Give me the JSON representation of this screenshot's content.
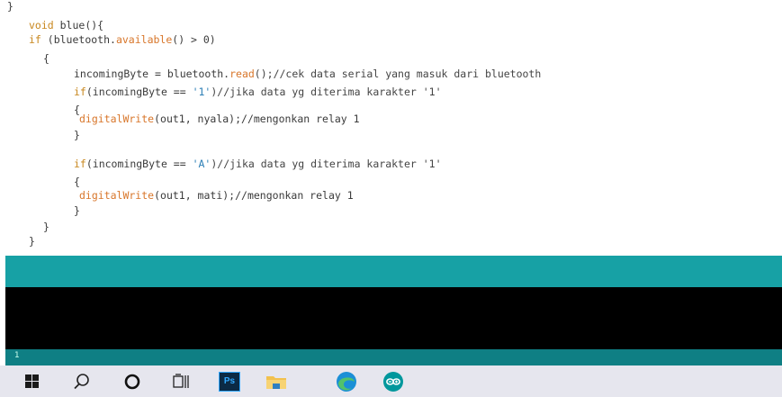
{
  "code": {
    "lines": [
      {
        "segments": [
          {
            "t": "}",
            "c": "pl"
          }
        ]
      },
      {
        "segments": [
          {
            "t": "void",
            "c": "kw"
          },
          {
            "t": " blue(){",
            "c": "pl"
          }
        ]
      },
      {
        "segments": [
          {
            "t": "if",
            "c": "kw"
          },
          {
            "t": " (bluetooth.",
            "c": "pl"
          },
          {
            "t": "available",
            "c": "fn"
          },
          {
            "t": "() > 0)",
            "c": "pl"
          }
        ]
      },
      {
        "segments": [
          {
            "t": "{",
            "c": "pl"
          }
        ]
      },
      {
        "segments": [
          {
            "t": "incomingByte = bluetooth.",
            "c": "pl"
          },
          {
            "t": "read",
            "c": "fn"
          },
          {
            "t": "();//cek data serial yang masuk dari bluetooth",
            "c": "cm"
          }
        ]
      },
      {
        "segments": [
          {
            "t": "if",
            "c": "kw"
          },
          {
            "t": "(incomingByte == ",
            "c": "pl"
          },
          {
            "t": "'1'",
            "c": "str"
          },
          {
            "t": ")//jika data yg diterima karakter '1'",
            "c": "cm"
          }
        ]
      },
      {
        "segments": [
          {
            "t": "{",
            "c": "pl"
          }
        ]
      },
      {
        "segments": [
          {
            "t": "digitalWrite",
            "c": "fn"
          },
          {
            "t": "(out1, nyala);//mengonkan relay 1",
            "c": "pl"
          }
        ]
      },
      {
        "segments": [
          {
            "t": "}",
            "c": "pl"
          }
        ]
      },
      {
        "segments": []
      },
      {
        "segments": [
          {
            "t": "if",
            "c": "kw"
          },
          {
            "t": "(incomingByte == ",
            "c": "pl"
          },
          {
            "t": "'A'",
            "c": "str"
          },
          {
            "t": ")//jika data yg diterima karakter '1'",
            "c": "cm"
          }
        ]
      },
      {
        "segments": [
          {
            "t": "{",
            "c": "pl"
          }
        ]
      },
      {
        "segments": [
          {
            "t": "digitalWrite",
            "c": "fn"
          },
          {
            "t": "(out1, mati);//mengonkan relay 1",
            "c": "pl"
          }
        ]
      },
      {
        "segments": [
          {
            "t": "}",
            "c": "pl"
          }
        ]
      },
      {
        "segments": [
          {
            "t": "}",
            "c": "pl"
          }
        ]
      },
      {
        "segments": [
          {
            "t": "}",
            "c": "pl"
          }
        ]
      }
    ]
  },
  "status": {
    "line_number": "1"
  },
  "taskbar": {
    "items": [
      {
        "name": "windows-start-icon"
      },
      {
        "name": "search-icon"
      },
      {
        "name": "cortana-icon"
      },
      {
        "name": "task-view-icon"
      },
      {
        "name": "photoshop-icon",
        "label": "Ps"
      },
      {
        "name": "file-explorer-icon"
      },
      {
        "name": "edge-browser-icon"
      },
      {
        "name": "arduino-ide-icon"
      }
    ]
  },
  "colors": {
    "console_header": "#17a1a5",
    "console_body": "#000000",
    "status_bar": "#0f7f84",
    "taskbar": "#e6e6ee",
    "keyword": "#c8871e",
    "function": "#d8762a",
    "string": "#2d7fb6"
  }
}
